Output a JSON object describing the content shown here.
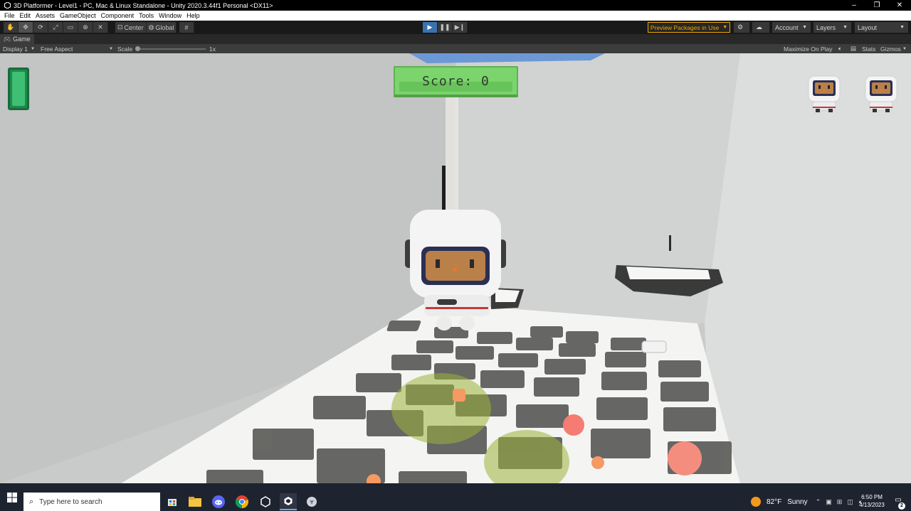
{
  "window": {
    "title": "3D Platformer - Level1 - PC, Mac & Linux Standalone - Unity 2020.3.44f1 Personal <DX11>",
    "controls": [
      "–",
      "❐",
      "✕"
    ]
  },
  "menu": [
    "File",
    "Edit",
    "Assets",
    "GameObject",
    "Component",
    "Tools",
    "Window",
    "Help"
  ],
  "toolbar": {
    "pivot_label": "Center",
    "space_label": "Global",
    "preview_packages": "Preview Packages in Use",
    "account": "Account",
    "layers": "Layers",
    "layout": "Layout"
  },
  "game_tab": {
    "label": "Game",
    "display": "Display 1",
    "aspect": "Free Aspect",
    "scale_label": "Scale",
    "scale_value": "1x",
    "maximize": "Maximize On Play",
    "stats": "Stats",
    "gizmos": "Gizmos"
  },
  "hud": {
    "score_text": "Score: 0",
    "lives": 2,
    "health_fraction": 1.0
  },
  "taskbar": {
    "search_placeholder": "Type here to search",
    "weather_temp": "82°F",
    "weather_desc": "Sunny",
    "time": "6:50 PM",
    "date": "4/13/2023",
    "notifications": "2"
  },
  "colors": {
    "accent_play": "#3a72b0",
    "preview_warning": "#f2a500",
    "score_panel": "#7bd46c",
    "health": "#3fbf73"
  }
}
